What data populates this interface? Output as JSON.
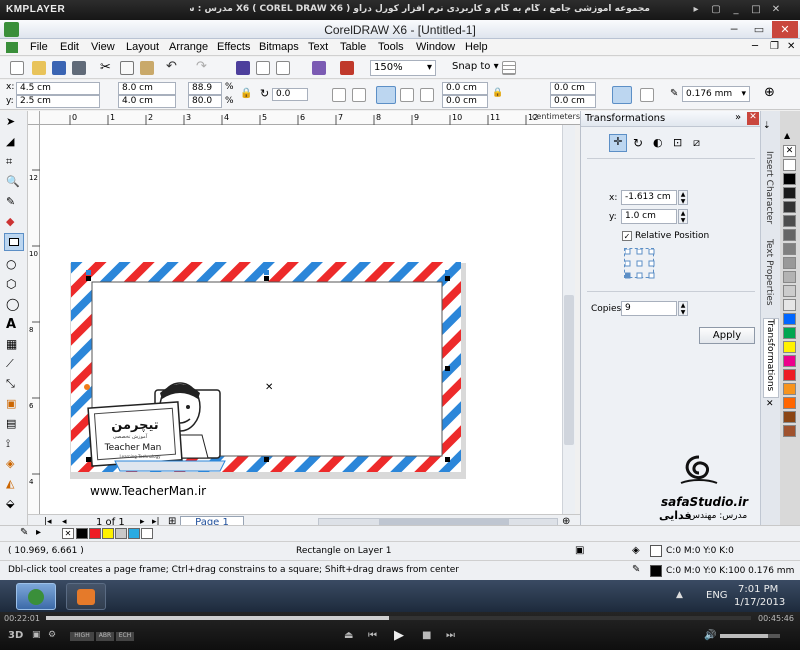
{
  "player": {
    "logo": "KMPLAYER",
    "title": "مجموعه آموزشی جامع ، گام به گام و کاربردی نرم افزار کورل دراو X6 ( COREL DRAW X6 )    مدرس : سعید فدایی ( تیچرمن ) گروه آموزشی پادشاه گرافیست ها",
    "time_elapsed": "00:22:01",
    "time_total": "00:45:46",
    "quality_tags": [
      "HIGH",
      "ABR",
      "ECH"
    ],
    "progress_fraction": 0.487
  },
  "app": {
    "title": "CorelDRAW X6 - [Untitled-1]"
  },
  "menu": [
    "File",
    "Edit",
    "View",
    "Layout",
    "Arrange",
    "Effects",
    "Bitmaps",
    "Text",
    "Table",
    "Tools",
    "Window",
    "Help"
  ],
  "toolbar": {
    "zoom": "150%",
    "snap_to": "Snap to"
  },
  "props": {
    "x": "4.5 cm",
    "y": "2.5 cm",
    "w": "8.0 cm",
    "h": "4.0 cm",
    "sx": "88.9",
    "sy": "80.0",
    "pct": "%",
    "angle": "0.0",
    "c1": "0.0 cm",
    "c2": "0.0 cm",
    "c3": "0.0 cm",
    "c4": "0.0 cm",
    "outline": "0.176 mm"
  },
  "rulers": {
    "h_ticks": [
      "0",
      "1",
      "2",
      "3",
      "4",
      "5",
      "6",
      "7",
      "8",
      "9",
      "10",
      "11",
      "12"
    ],
    "units": "centimeters",
    "v_ticks": [
      "12",
      "10",
      "8",
      "6",
      "4"
    ]
  },
  "canvas": {
    "website": "www.TeacherMan.ir",
    "teacher_name": "Teacher Man",
    "logo_fa": "تیچرمن",
    "logo_sub": "آموزش تخصصی",
    "logo_sub2": "Learning Technology"
  },
  "docker": {
    "title": "Transformations",
    "x_label": "x:",
    "x_value": "-1.613 cm",
    "y_label": "y:",
    "y_value": "1.0 cm",
    "relative_position": "Relative Position",
    "copies_label": "Copies:",
    "copies_value": "9",
    "apply": "Apply",
    "watermark_site": "safaStudio.ir",
    "watermark_teacher": "مدرس: مهندس",
    "watermark_name": "فدایی"
  },
  "docker_tabs": [
    "Insert Character",
    "Text Properties",
    "Transformations"
  ],
  "palette_colors": [
    "#ffffff",
    "#000000",
    "#1a1a1a",
    "#333333",
    "#4d4d4d",
    "#666666",
    "#808080",
    "#999999",
    "#b3b3b3",
    "#cccccc",
    "#e6e6e6",
    "#0066ff",
    "#00a651",
    "#fff200",
    "#ec008c",
    "#ed1c24",
    "#f7941d",
    "#ff6600",
    "#8b4513",
    "#a0522d"
  ],
  "page_nav": {
    "count": "1 of 1",
    "tab": "Page 1"
  },
  "status": {
    "coords": "( 10.969, 6.661 )",
    "object": "Rectangle on Layer 1",
    "fill": "C:0 M:0 Y:0 K:0",
    "outline": "C:0 M:0 Y:0 K:100  0.176 mm",
    "hint": "Dbl-click tool creates a page frame; Ctrl+drag constrains to a square; Shift+drag draws from center"
  },
  "taskbar": {
    "lang": "ENG",
    "time": "7:01 PM",
    "date": "1/17/2013"
  },
  "doc_palette": [
    "#000000",
    "#ed1c24",
    "#fff200",
    "#c8c8c8",
    "#29abe2",
    "#ffffff"
  ]
}
